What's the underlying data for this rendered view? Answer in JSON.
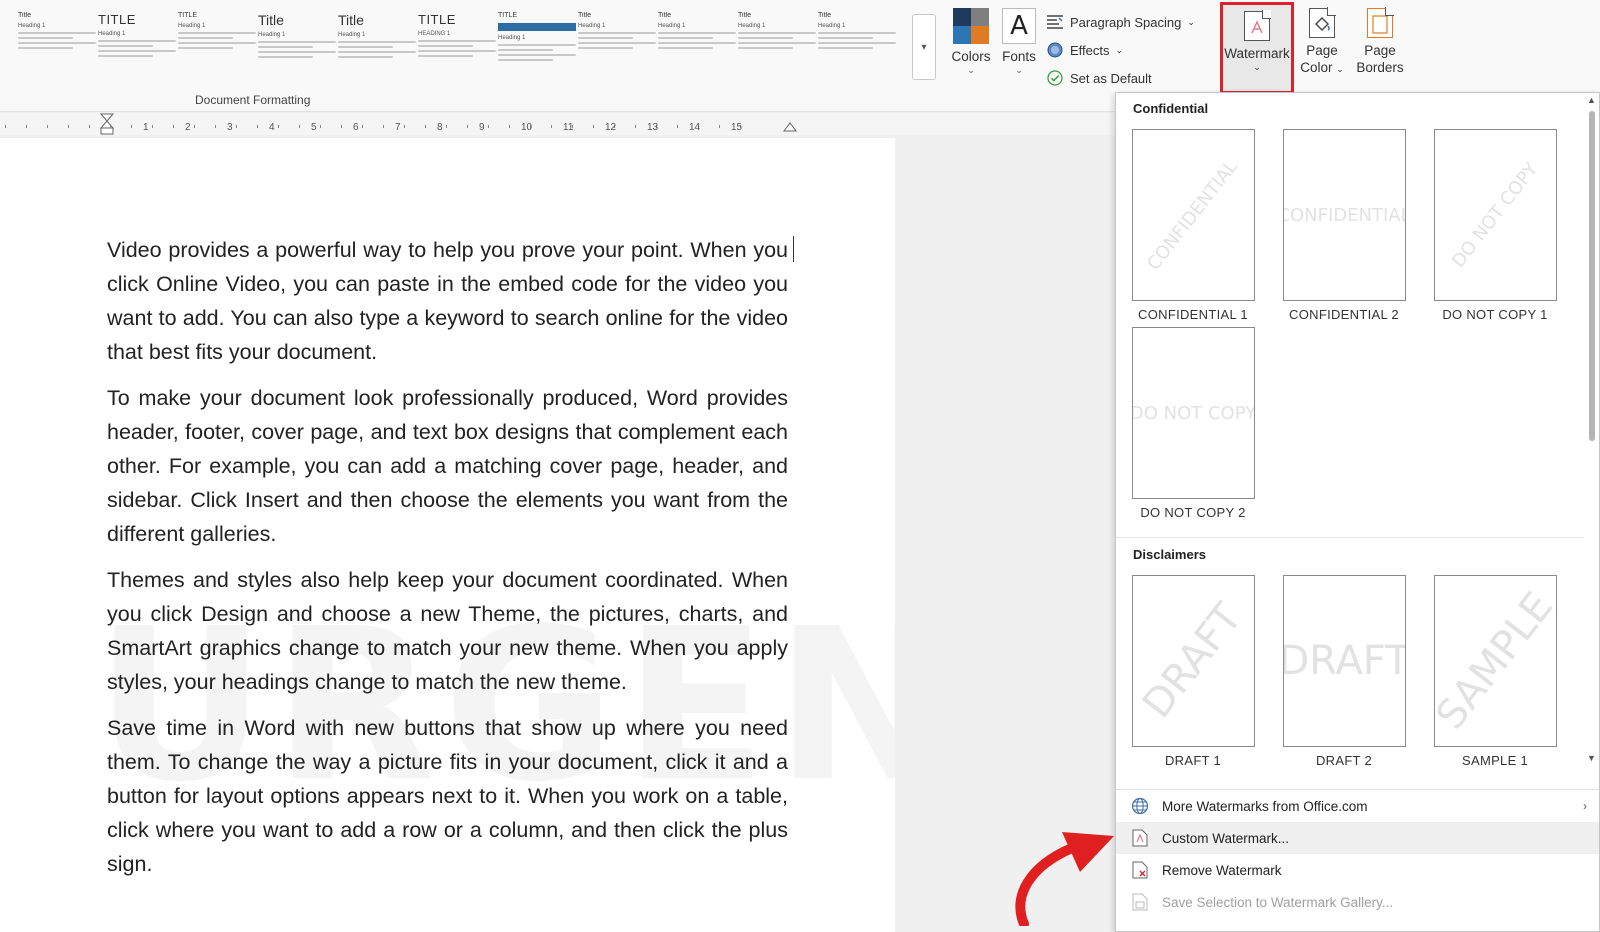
{
  "ribbon": {
    "document_formatting": {
      "group_label": "Document Formatting",
      "style_sets": [
        {
          "title": "Title",
          "heading": "Heading 1",
          "variant": "tiny"
        },
        {
          "title": "TITLE",
          "heading": "Heading 1",
          "variant": "upper"
        },
        {
          "title": "TITLE",
          "heading": "Heading 1",
          "variant": "tiny"
        },
        {
          "title": "Title",
          "heading": "Heading 1",
          "variant": "big"
        },
        {
          "title": "Title",
          "heading": "Heading 1",
          "variant": "big"
        },
        {
          "title": "TITLE",
          "heading": "HEADING 1",
          "variant": "upper"
        },
        {
          "title": "TITLE",
          "heading": "Heading 1",
          "variant": "blue"
        },
        {
          "title": "Title",
          "heading": "Heading 1",
          "variant": "tiny"
        },
        {
          "title": "Title",
          "heading": "Heading 1",
          "variant": "tiny"
        },
        {
          "title": "Title",
          "heading": "Heading 1",
          "variant": "tiny"
        },
        {
          "title": "Title",
          "heading": "Heading 1",
          "variant": "tiny"
        }
      ]
    },
    "colors_label": "Colors",
    "fonts_label": "Fonts",
    "fonts_glyph": "A",
    "paragraph_spacing_label": "Paragraph Spacing",
    "effects_label": "Effects",
    "set_as_default_label": "Set as Default",
    "watermark_label": "Watermark",
    "page_color_label_1": "Page",
    "page_color_label_2": "Color",
    "page_borders_label_1": "Page",
    "page_borders_label_2": "Borders"
  },
  "ruler": {
    "numbers": [
      "1",
      "2",
      "3",
      "4",
      "5",
      "6",
      "7",
      "8",
      "9",
      "10",
      "11",
      "12",
      "13",
      "14",
      "15"
    ]
  },
  "document": {
    "paragraphs": [
      "Video provides a powerful way to help you prove your point. When you click Online Video, you can paste in the embed code for the video you want to add. You can also type a keyword to search online for the video that best fits your document.",
      "To make your document look professionally produced, Word provides header, footer, cover page, and text box designs that complement each other. For example, you can add a matching cover page, header, and sidebar. Click Insert and then choose the elements you want from the different galleries.",
      "Themes and styles also help keep your document coordinated. When you click Design and choose a new Theme, the pictures, charts, and SmartArt graphics change to match your new theme. When you apply styles, your headings change to match the new theme.",
      "Save time in Word with new buttons that show up where you need them. To change the way a picture fits in your document, click it and a button for layout options appears next to it. When you work on a table, click where you want to add a row or a column, and then click the plus sign."
    ],
    "watermark_text": "URGENT"
  },
  "watermark_menu": {
    "sections": [
      {
        "title": "Confidential",
        "items": [
          {
            "caption": "CONFIDENTIAL 1",
            "text": "CONFIDENTIAL",
            "style": "diagonal"
          },
          {
            "caption": "CONFIDENTIAL 2",
            "text": "CONFIDENTIAL",
            "style": "horizontal"
          },
          {
            "caption": "DO NOT COPY 1",
            "text": "DO NOT COPY",
            "style": "diagonal"
          },
          {
            "caption": "DO NOT COPY 2",
            "text": "DO NOT COPY",
            "style": "horizontal"
          }
        ]
      },
      {
        "title": "Disclaimers",
        "items": [
          {
            "caption": "DRAFT 1",
            "text": "DRAFT",
            "style": "diagonal"
          },
          {
            "caption": "DRAFT 2",
            "text": "DRAFT",
            "style": "horizontal"
          },
          {
            "caption": "SAMPLE 1",
            "text": "SAMPLE",
            "style": "diagonal"
          }
        ]
      }
    ],
    "commands": [
      {
        "label": "More Watermarks from Office.com",
        "icon": "globe-icon",
        "has_submenu": true,
        "state": "normal"
      },
      {
        "label": "Custom Watermark...",
        "icon": "custom-watermark-icon",
        "has_submenu": false,
        "state": "hover"
      },
      {
        "label": "Remove Watermark",
        "icon": "remove-watermark-icon",
        "has_submenu": false,
        "state": "normal"
      },
      {
        "label": "Save Selection to Watermark Gallery...",
        "icon": "save-gallery-icon",
        "has_submenu": false,
        "state": "disabled"
      }
    ]
  },
  "colors": {
    "highlight_border": "#d9232d",
    "arrow": "#e02020",
    "colors_icon_dark": "#1f3a5f",
    "colors_icon_orange": "#e07b25",
    "colors_icon_blue": "#2e75b6",
    "colors_icon_gray": "#7f7f7f"
  }
}
